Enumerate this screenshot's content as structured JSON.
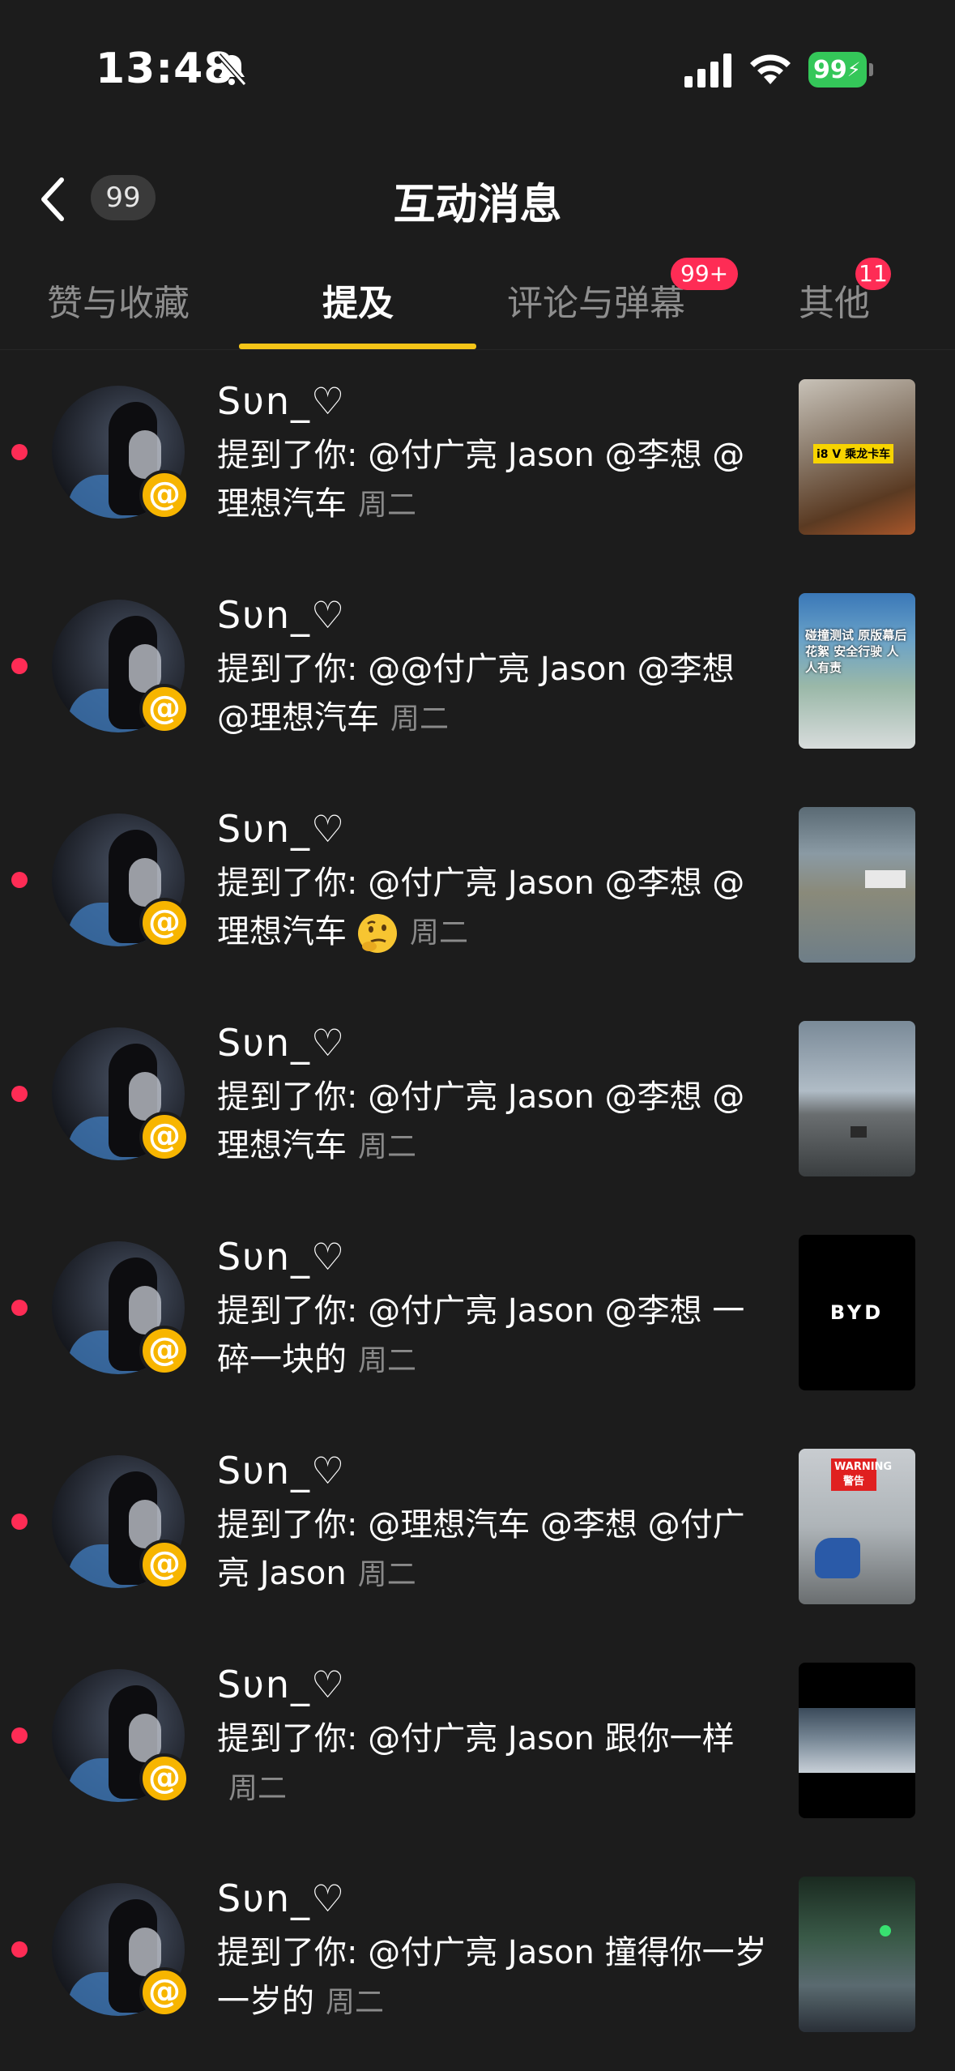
{
  "status": {
    "time": "13:48",
    "battery": "99"
  },
  "header": {
    "back_count": "99",
    "title": "互动消息"
  },
  "tabs": [
    {
      "label": "赞与收藏",
      "badge": ""
    },
    {
      "label": "提及",
      "badge": ""
    },
    {
      "label": "评论与弹幕",
      "badge": "99+"
    },
    {
      "label": "其他",
      "badge": "11"
    }
  ],
  "at_symbol": "@",
  "messages": [
    {
      "user": "Sυn_♡",
      "text": "提到了你: @付广亮 Jason @李想 @理想汽车",
      "time": "周二",
      "thumb_text": "i8 V 乘龙卡车"
    },
    {
      "user": "Sυn_♡",
      "text": "提到了你: @@付广亮 Jason @李想 @理想汽车",
      "time": "周二",
      "thumb_text": "碰撞测试 原版幕后花絮 安全行驶 人人有责"
    },
    {
      "user": "Sυn_♡",
      "text": "提到了你: @付广亮 Jason @李想 @理想汽车",
      "time": "周二",
      "thumb_text": ""
    },
    {
      "user": "Sυn_♡",
      "text": "提到了你: @付广亮 Jason @李想 @理想汽车",
      "time": "周二",
      "thumb_text": ""
    },
    {
      "user": "Sυn_♡",
      "text": "提到了你: @付广亮 Jason @李想 一碎一块的",
      "time": "周二",
      "thumb_text": "BYD"
    },
    {
      "user": "Sυn_♡",
      "text": "提到了你: @理想汽车 @李想 @付广亮 Jason",
      "time": "周二",
      "thumb_text": "WARNING 警告"
    },
    {
      "user": "Sυn_♡",
      "text": "提到了你: @付广亮 Jason 跟你一样",
      "time": "周二",
      "thumb_text": ""
    },
    {
      "user": "Sυn_♡",
      "text": "提到了你: @付广亮 Jason 撞得你一岁一岁的",
      "time": "周二",
      "thumb_text": ""
    }
  ],
  "icons": {
    "mute": "bell-slash-icon",
    "signal": "cellular-signal-icon",
    "wifi": "wifi-icon",
    "back": "chevron-left-icon",
    "emoji": "thinking-face-icon"
  },
  "colors": {
    "background": "#1c1c1c",
    "accent": "#f5c518",
    "badge": "#fe2c55",
    "at_badge": "#f7b500",
    "battery": "#34c759"
  }
}
